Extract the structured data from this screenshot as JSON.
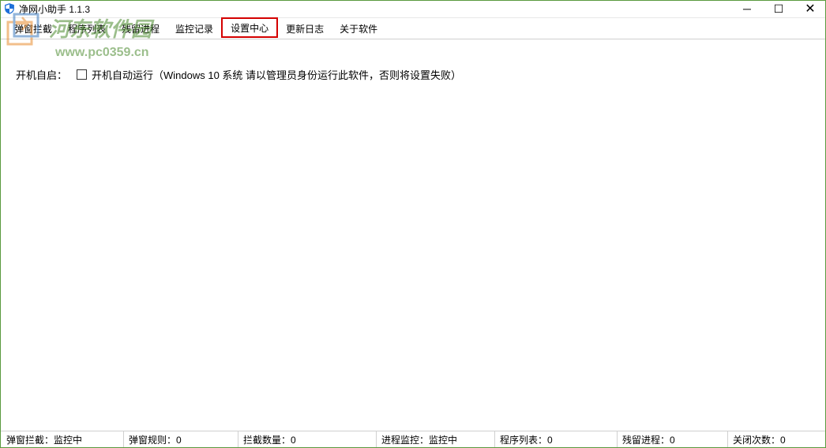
{
  "window": {
    "title": "净网小助手 1.1.3"
  },
  "tabs": [
    {
      "label": "弹窗拦截"
    },
    {
      "label": "程序列表"
    },
    {
      "label": "残留进程"
    },
    {
      "label": "监控记录"
    },
    {
      "label": "设置中心"
    },
    {
      "label": "更新日志"
    },
    {
      "label": "关于软件"
    }
  ],
  "settings": {
    "autostart_label": "开机自启：",
    "autostart_checkbox_label": "开机自动运行（Windows 10 系统 请以管理员身份运行此软件，否则将设置失败）"
  },
  "watermark": {
    "text": "河东软件园",
    "url": "www.pc0359.cn"
  },
  "statusbar": {
    "item1_label": "弹窗拦截：",
    "item1_value": "监控中",
    "item2_label": "弹窗规则：",
    "item2_value": "0",
    "item3_label": "拦截数量：",
    "item3_value": "0",
    "item4_label": "进程监控：",
    "item4_value": "监控中",
    "item5_label": "程序列表：",
    "item5_value": "0",
    "item6_label": "残留进程：",
    "item6_value": "0",
    "item7_label": "关闭次数：",
    "item7_value": "0"
  }
}
